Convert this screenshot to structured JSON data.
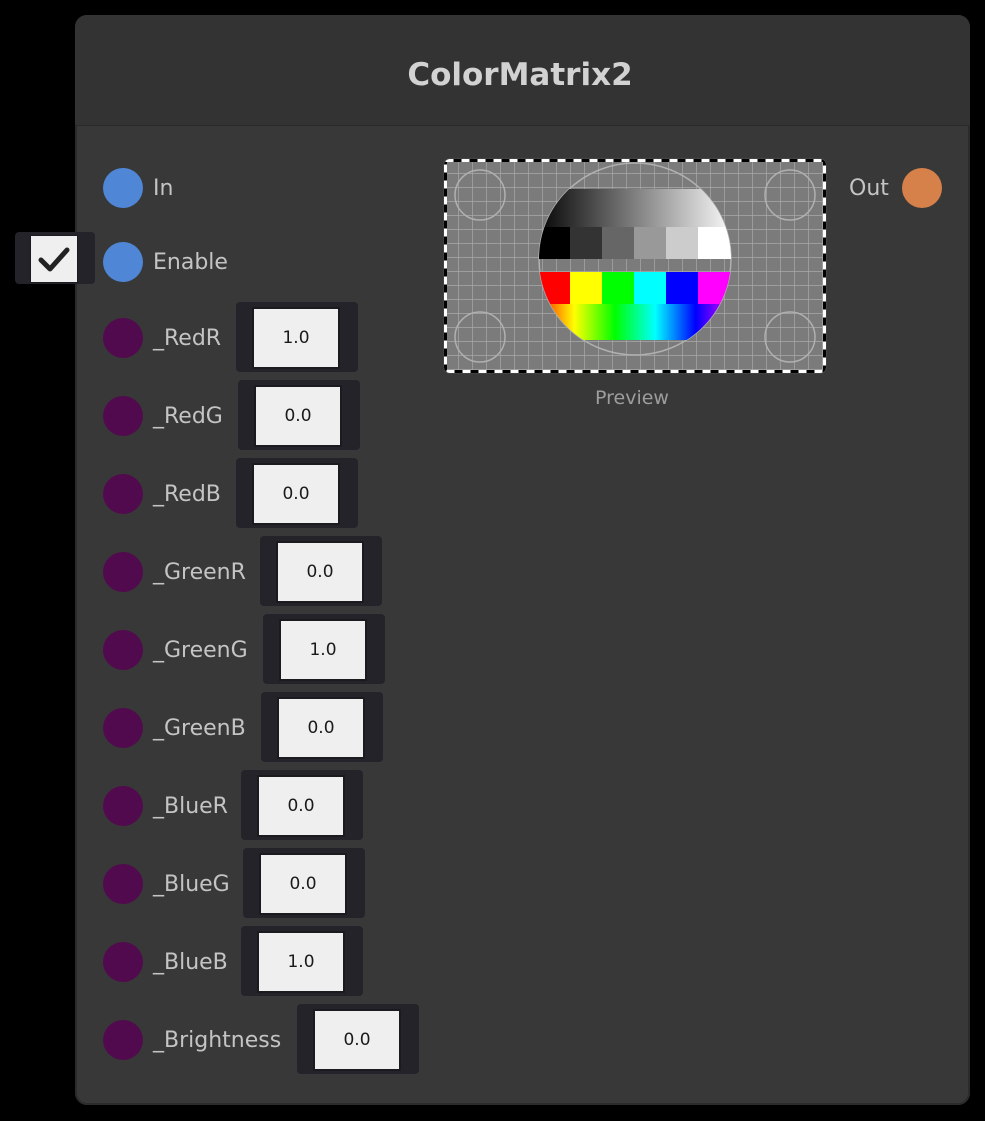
{
  "node": {
    "title": "ColorMatrix2",
    "preview_label": "Preview",
    "output": {
      "label": "Out",
      "color": "#d68149"
    },
    "inputs": {
      "in": {
        "label": "In",
        "color": "#4f86d6"
      },
      "enable": {
        "label": "Enable",
        "color": "#4f86d6",
        "checked": true
      }
    },
    "property_port_color": "#520a4f",
    "properties": [
      {
        "label": "_RedR",
        "value": "1.0"
      },
      {
        "label": "_RedG",
        "value": "0.0"
      },
      {
        "label": "_RedB",
        "value": "0.0"
      },
      {
        "label": "_GreenR",
        "value": "0.0"
      },
      {
        "label": "_GreenG",
        "value": "1.0"
      },
      {
        "label": "_GreenB",
        "value": "0.0"
      },
      {
        "label": "_BlueR",
        "value": "0.0"
      },
      {
        "label": "_BlueG",
        "value": "0.0"
      },
      {
        "label": "_BlueB",
        "value": "1.0"
      },
      {
        "label": "_Brightness",
        "value": "0.0"
      }
    ]
  }
}
